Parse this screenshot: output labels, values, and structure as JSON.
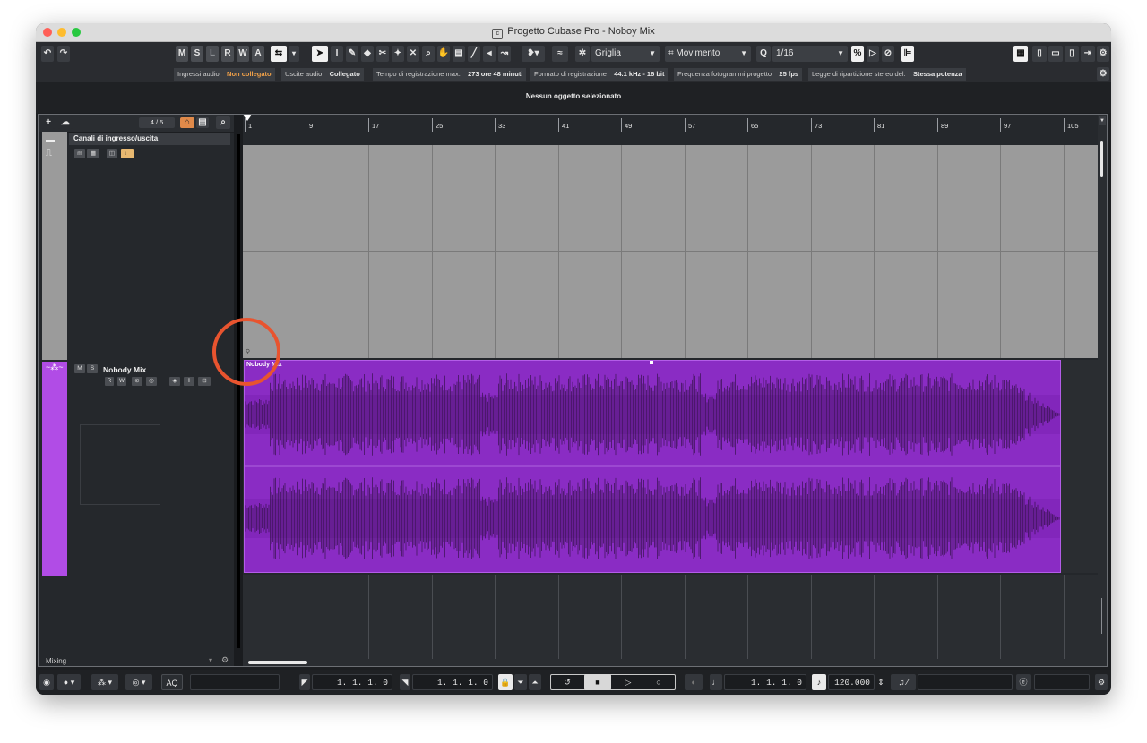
{
  "window": {
    "title": "Progetto Cubase Pro - Noboy Mix",
    "colors": {
      "close": "#ff5f57",
      "minimize": "#febc2e",
      "maximize": "#28c840"
    }
  },
  "toolbar": {
    "undo_icon": "undo-icon",
    "redo_icon": "redo-icon",
    "state_buttons": [
      "M",
      "S",
      "L",
      "R",
      "W",
      "A"
    ],
    "snap_type": "Griglia",
    "grid_mode": "Movimento",
    "quantize_value": "1/16",
    "quantize_icon": "Q"
  },
  "infobar": {
    "audio_inputs_label": "Ingressi audio",
    "audio_inputs_value": "Non collegato",
    "audio_outputs_label": "Uscite audio",
    "audio_outputs_value": "Collegato",
    "rec_time_label": "Tempo di registrazione max.",
    "rec_time_value": "273 ore 48 minuti",
    "rec_format_label": "Formato di registrazione",
    "rec_format_value": "44.1 kHz - 16 bit",
    "frame_rate_label": "Frequenza fotogrammi progetto",
    "frame_rate_value": "25 fps",
    "pan_law_label": "Legge di ripartizione stereo del.",
    "pan_law_value": "Stessa potenza"
  },
  "status": {
    "text": "Nessun oggetto selezionato"
  },
  "tracklist": {
    "counter": "4 / 5",
    "folder_track": {
      "name": "Canali di ingresso/uscita"
    },
    "audio_track": {
      "name": "Nobody Mix",
      "buttons": [
        "R",
        "W"
      ],
      "mute": "M",
      "solo": "S"
    },
    "footer": "Mixing"
  },
  "ruler": {
    "bars": [
      "1",
      "9",
      "17",
      "25",
      "33",
      "41",
      "49",
      "57",
      "65",
      "73",
      "81",
      "89",
      "97",
      "105"
    ]
  },
  "event": {
    "name": "Nobody Mix",
    "color": "#8a2cc4"
  },
  "transport": {
    "left_locator": "1. 1. 1.   0",
    "right_locator": "1. 1. 1.   0",
    "position": "1. 1. 1.   0",
    "tempo": "120.000",
    "aq_label": "AQ"
  },
  "annotation": {
    "color": "#e8542f"
  }
}
